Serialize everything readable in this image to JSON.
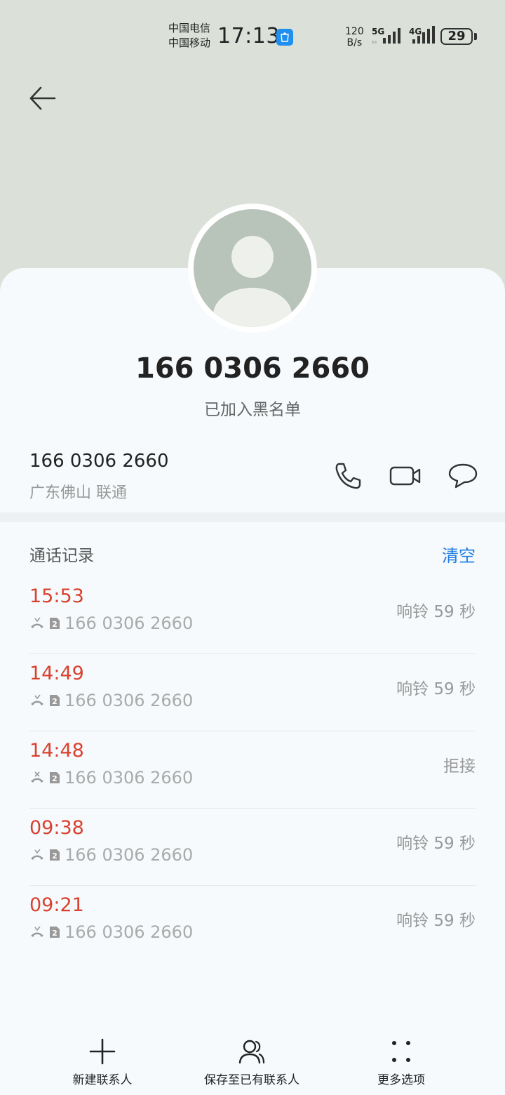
{
  "status_bar": {
    "carrier1": "中国电信",
    "carrier2": "中国移动",
    "time": "17:13",
    "net_speed_value": "120",
    "net_speed_unit": "B/s",
    "network1": "5G",
    "network2": "4G",
    "battery": "29"
  },
  "contact": {
    "number": "166 0306 2660",
    "status": "已加入黑名单",
    "number_row": "166 0306 2660",
    "location": "广东佛山 联通"
  },
  "call_log": {
    "title": "通话记录",
    "clear_label": "清空",
    "items": [
      {
        "time": "15:53",
        "number": "166 0306 2660",
        "status": "响铃 59 秒"
      },
      {
        "time": "14:49",
        "number": "166 0306 2660",
        "status": "响铃 59 秒"
      },
      {
        "time": "14:48",
        "number": "166 0306 2660",
        "status": "拒接"
      },
      {
        "time": "09:38",
        "number": "166 0306 2660",
        "status": "响铃 59 秒"
      },
      {
        "time": "09:21",
        "number": "166 0306 2660",
        "status": "响铃 59 秒"
      }
    ]
  },
  "bottom_bar": {
    "new_contact": "新建联系人",
    "save_existing": "保存至已有联系人",
    "more_options": "更多选项"
  },
  "colors": {
    "missed_time": "#d9412f",
    "accent": "#1e7de0",
    "header_bg": "#dbe1d9"
  },
  "icons": {
    "back": "arrow-left-icon",
    "call": "phone-icon",
    "video": "video-camera-icon",
    "message": "chat-bubble-icon",
    "new_contact": "plus-icon",
    "save_existing": "contacts-icon",
    "more": "dots-grid-icon"
  }
}
